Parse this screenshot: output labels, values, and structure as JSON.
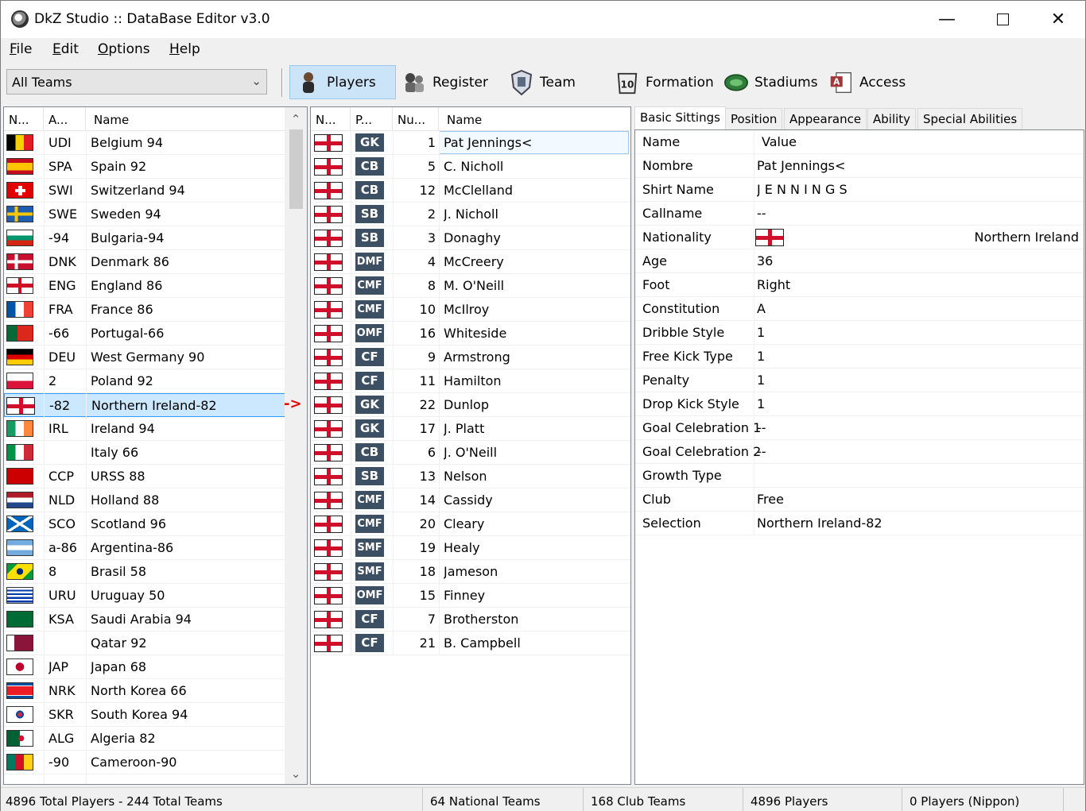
{
  "window": {
    "title": "DkZ Studio :: DataBase Editor v3.0"
  },
  "menu": [
    "File",
    "Edit",
    "Options",
    "Help"
  ],
  "toolbar": {
    "team_filter": "All Teams",
    "buttons": [
      {
        "label": "Players",
        "icon": "player-icon"
      },
      {
        "label": "Register",
        "icon": "register-icon"
      },
      {
        "label": "Team",
        "icon": "team-shield-icon"
      },
      {
        "label": "Formation",
        "icon": "formation-icon"
      },
      {
        "label": "Stadiums",
        "icon": "stadium-icon"
      },
      {
        "label": "Access",
        "icon": "access-icon"
      }
    ]
  },
  "teams": {
    "columns": [
      "N...",
      "A...",
      "Name"
    ],
    "rows": [
      {
        "abbr": "UDI",
        "name": "Belgium 94",
        "flag": "belgium"
      },
      {
        "abbr": "SPA",
        "name": "Spain 92",
        "flag": "spain"
      },
      {
        "abbr": "SWI",
        "name": "Switzerland 94",
        "flag": "switzerland"
      },
      {
        "abbr": "SWE",
        "name": "Sweden 94",
        "flag": "sweden"
      },
      {
        "abbr": "-94",
        "name": "Bulgaria-94",
        "flag": "bulgaria"
      },
      {
        "abbr": "DNK",
        "name": "Denmark 86",
        "flag": "denmark"
      },
      {
        "abbr": "ENG",
        "name": "England 86",
        "flag": "england"
      },
      {
        "abbr": "FRA",
        "name": "France 86",
        "flag": "france"
      },
      {
        "abbr": "-66",
        "name": "Portugal-66",
        "flag": "portugal"
      },
      {
        "abbr": "DEU",
        "name": "West Germany 90",
        "flag": "germany"
      },
      {
        "abbr": "2",
        "name": "Poland 92",
        "flag": "poland"
      },
      {
        "abbr": "-82",
        "name": "Northern Ireland-82",
        "flag": "nireland"
      },
      {
        "abbr": "IRL",
        "name": "Ireland 94",
        "flag": "ireland"
      },
      {
        "abbr": "",
        "name": "Italy 66",
        "flag": "italy"
      },
      {
        "abbr": "CCP",
        "name": "URSS 88",
        "flag": "ussr"
      },
      {
        "abbr": "NLD",
        "name": "Holland 88",
        "flag": "netherlands"
      },
      {
        "abbr": "SCO",
        "name": "Scotland 96",
        "flag": "scotland"
      },
      {
        "abbr": "a-86",
        "name": "Argentina-86",
        "flag": "argentina"
      },
      {
        "abbr": "8",
        "name": "Brasil 58",
        "flag": "brazil"
      },
      {
        "abbr": "URU",
        "name": "Uruguay 50",
        "flag": "uruguay"
      },
      {
        "abbr": "KSA",
        "name": "Saudi Arabia 94",
        "flag": "saudi"
      },
      {
        "abbr": "",
        "name": "Qatar 92",
        "flag": "qatar"
      },
      {
        "abbr": "JAP",
        "name": "Japan 68",
        "flag": "japan"
      },
      {
        "abbr": "NRK",
        "name": "North Korea 66",
        "flag": "nkorea"
      },
      {
        "abbr": "SKR",
        "name": "South Korea 94",
        "flag": "skorea"
      },
      {
        "abbr": "ALG",
        "name": "Algeria 82",
        "flag": "algeria"
      },
      {
        "abbr": "-90",
        "name": "Cameroon-90",
        "flag": "cameroon"
      }
    ]
  },
  "players": {
    "columns": [
      "N...",
      "P...",
      "Nu...",
      "Name"
    ],
    "rows": [
      {
        "pos": "GK",
        "num": "1",
        "name": "Pat Jennings<"
      },
      {
        "pos": "CB",
        "num": "5",
        "name": "C. Nicholl"
      },
      {
        "pos": "CB",
        "num": "12",
        "name": "McClelland"
      },
      {
        "pos": "SB",
        "num": "2",
        "name": "J. Nicholl"
      },
      {
        "pos": "SB",
        "num": "3",
        "name": "Donaghy"
      },
      {
        "pos": "DMF",
        "num": "4",
        "name": "McCreery"
      },
      {
        "pos": "CMF",
        "num": "8",
        "name": "M. O'Neill"
      },
      {
        "pos": "CMF",
        "num": "10",
        "name": "McIlroy"
      },
      {
        "pos": "OMF",
        "num": "16",
        "name": "Whiteside"
      },
      {
        "pos": "CF",
        "num": "9",
        "name": "Armstrong"
      },
      {
        "pos": "CF",
        "num": "11",
        "name": "Hamilton"
      },
      {
        "pos": "GK",
        "num": "22",
        "name": "Dunlop"
      },
      {
        "pos": "GK",
        "num": "17",
        "name": "J. Platt"
      },
      {
        "pos": "CB",
        "num": "6",
        "name": "J. O'Neill"
      },
      {
        "pos": "SB",
        "num": "13",
        "name": "Nelson"
      },
      {
        "pos": "CMF",
        "num": "14",
        "name": "Cassidy"
      },
      {
        "pos": "CMF",
        "num": "20",
        "name": "Cleary"
      },
      {
        "pos": "SMF",
        "num": "19",
        "name": "Healy"
      },
      {
        "pos": "SMF",
        "num": "18",
        "name": "Jameson"
      },
      {
        "pos": "OMF",
        "num": "15",
        "name": "Finney"
      },
      {
        "pos": "CF",
        "num": "7",
        "name": "Brotherston"
      },
      {
        "pos": "CF",
        "num": "21",
        "name": "B. Campbell"
      }
    ]
  },
  "tabs": [
    "Basic Sittings",
    "Position",
    "Appearance",
    "Ability",
    "Special Abilities"
  ],
  "properties": {
    "columns": [
      "Name",
      "Value"
    ],
    "rows": [
      {
        "key": "Nombre",
        "value": "Pat Jennings<"
      },
      {
        "key": "Shirt Name",
        "value": "J E N N I N G S"
      },
      {
        "key": "Callname",
        "value": "--"
      },
      {
        "key": "Nationality",
        "value": "Northern Ireland",
        "flag": true
      },
      {
        "key": "Age",
        "value": "36"
      },
      {
        "key": "Foot",
        "value": "Right"
      },
      {
        "key": "Constitution",
        "value": "A"
      },
      {
        "key": "Dribble Style",
        "value": "1"
      },
      {
        "key": "Free Kick Type",
        "value": "1"
      },
      {
        "key": "Penalty",
        "value": "1"
      },
      {
        "key": "Drop Kick Style",
        "value": "1"
      },
      {
        "key": "Goal Celebration 1",
        "value": "--"
      },
      {
        "key": "Goal Celebration 2",
        "value": "--"
      },
      {
        "key": "Growth Type",
        "value": ""
      },
      {
        "key": "Club",
        "value": "Free"
      },
      {
        "key": "Selection",
        "value": "Northern Ireland-82"
      }
    ]
  },
  "selection_arrow": "->",
  "status": [
    "4896 Total Players  -  244 Total Teams",
    "64 National Teams",
    "168 Club Teams",
    "4896 Players",
    "0 Players (Nippon)"
  ]
}
